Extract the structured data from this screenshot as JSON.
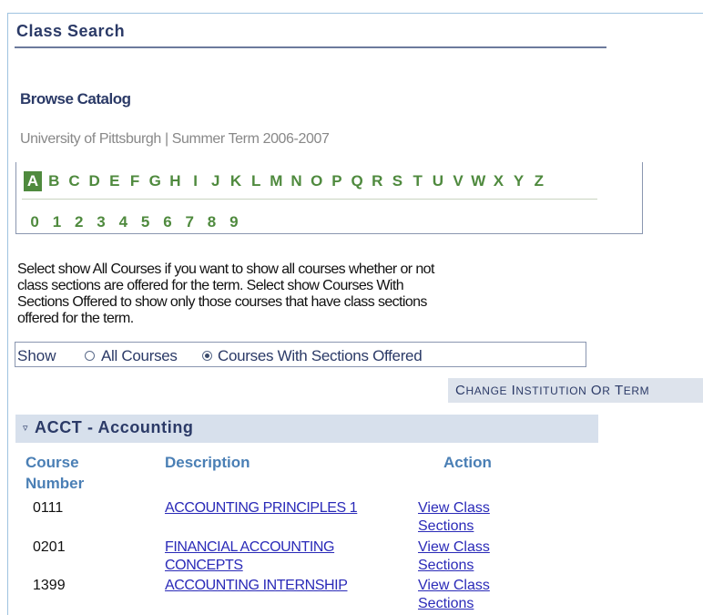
{
  "page": {
    "title": "Class Search"
  },
  "browse": {
    "title": "Browse Catalog",
    "institution_term": "University of Pittsburgh | Summer Term 2006-2007",
    "letters": [
      "A",
      "B",
      "C",
      "D",
      "E",
      "F",
      "G",
      "H",
      "I",
      "J",
      "K",
      "L",
      "M",
      "N",
      "O",
      "P",
      "Q",
      "R",
      "S",
      "T",
      "U",
      "V",
      "W",
      "X",
      "Y",
      "Z"
    ],
    "digits": [
      "0",
      "1",
      "2",
      "3",
      "4",
      "5",
      "6",
      "7",
      "8",
      "9"
    ],
    "selected_letter": "A"
  },
  "instructions": {
    "line1": "Select show All Courses if you want to show all courses whether or not",
    "line2": "class sections are offered for the term. Select show Courses With",
    "line3": "Sections Offered to show only those courses that have class sections",
    "line4": "offered for the term."
  },
  "show": {
    "label": "Show",
    "option_all": "All Courses",
    "option_offered": "Courses With Sections Offered",
    "selected": "Courses With Sections Offered"
  },
  "change_button": "Change Institution Or Term",
  "subject": {
    "title": "ACCT - Accounting"
  },
  "columns": {
    "course_number_1": "Course",
    "course_number_2": "Number",
    "description": "Description",
    "action": "Action"
  },
  "courses": [
    {
      "number": "0111",
      "desc_1": "ACCOUNTING PRINCIPLES 1",
      "desc_2": "",
      "action_1": "View Class",
      "action_2": "Sections"
    },
    {
      "number": "0201",
      "desc_1": "FINANCIAL ACCOUNTING",
      "desc_2": "CONCEPTS",
      "action_1": "View Class",
      "action_2": "Sections"
    },
    {
      "number": "1399",
      "desc_1": "ACCOUNTING INTERNSHIP",
      "desc_2": "",
      "action_1": "View Class",
      "action_2": "Sections"
    }
  ],
  "colors": {
    "title": "#2b3a67",
    "alpha_link": "#4f8a3e",
    "column_header": "#4a7fb5",
    "link": "#2a2ab8",
    "subject_bar": "#d7e0ec"
  }
}
